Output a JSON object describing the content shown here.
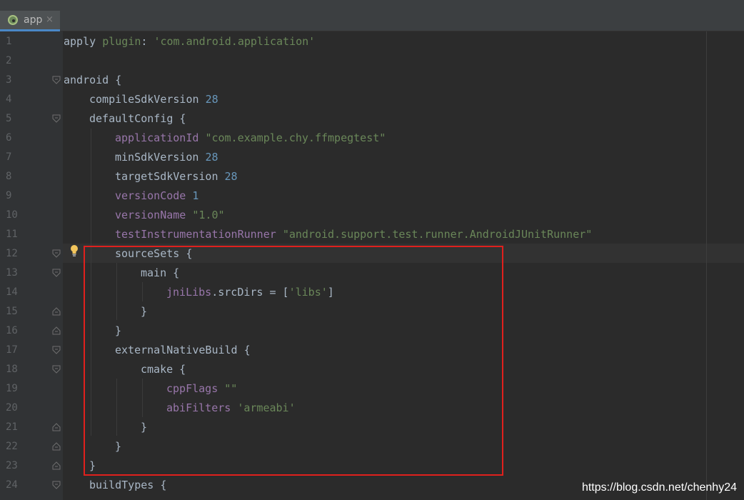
{
  "tab": {
    "label": "app",
    "close_glyph": "×"
  },
  "line_numbers": [
    "1",
    "2",
    "3",
    "4",
    "5",
    "6",
    "7",
    "8",
    "9",
    "10",
    "11",
    "12",
    "13",
    "14",
    "15",
    "16",
    "17",
    "18",
    "19",
    "20",
    "21",
    "22",
    "23",
    "24"
  ],
  "code": {
    "l1": {
      "a": "apply ",
      "b": "plugin",
      "c": ": ",
      "d": "'com.android.application'"
    },
    "l3": {
      "a": "android {"
    },
    "l4": {
      "a": "compileSdkVersion ",
      "b": "28"
    },
    "l5": {
      "a": "defaultConfig {"
    },
    "l6": {
      "a": "applicationId ",
      "b": "\"com.example.chy.ffmpegtest\""
    },
    "l7": {
      "a": "minSdkVersion ",
      "b": "28"
    },
    "l8": {
      "a": "targetSdkVersion ",
      "b": "28"
    },
    "l9": {
      "a": "versionCode ",
      "b": "1"
    },
    "l10": {
      "a": "versionName ",
      "b": "\"1.0\""
    },
    "l11": {
      "a": "testInstrumentationRunner ",
      "b": "\"android.support.test.runner.AndroidJUnitRunner\""
    },
    "l12": {
      "a": "sourceSets {"
    },
    "l13": {
      "a": "main {"
    },
    "l14": {
      "a": "jniLibs",
      "b": ".srcDirs = [",
      "c": "'libs'",
      "d": "]"
    },
    "l15": {
      "a": "}"
    },
    "l16": {
      "a": "}"
    },
    "l17": {
      "a": "externalNativeBuild {"
    },
    "l18": {
      "a": "cmake {"
    },
    "l19": {
      "a": "cppFlags ",
      "b": "\"\""
    },
    "l20": {
      "a": "abiFilters ",
      "b": "'armeabi'"
    },
    "l21": {
      "a": "}"
    },
    "l22": {
      "a": "}"
    },
    "l23": {
      "a": "}"
    },
    "l24": {
      "a": "buildTypes {"
    }
  },
  "watermark": "https://blog.csdn.net/chenhy24",
  "colors": {
    "editor_bg": "#2b2b2b",
    "gutter_bg": "#313335",
    "string": "#6a8759",
    "number": "#6897bb",
    "property": "#9876aa",
    "highlight_box": "#e0201d"
  }
}
